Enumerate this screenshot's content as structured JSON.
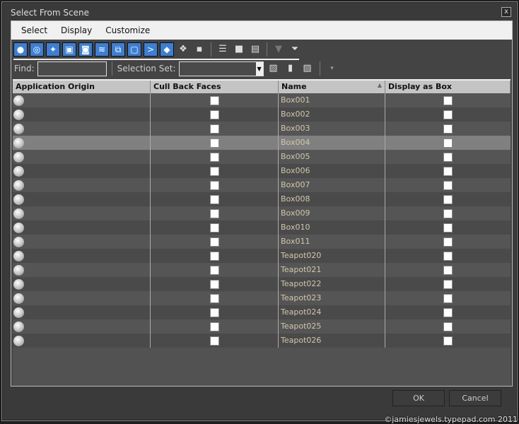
{
  "window": {
    "title": "Select From Scene",
    "close": "x"
  },
  "menu": [
    "Select",
    "Display",
    "Customize"
  ],
  "toolbar": {
    "find_label": "Find:",
    "find_value": "",
    "selection_set_label": "Selection Set:",
    "selection_set_value": ""
  },
  "columns": [
    "Application Origin",
    "Cull Back Faces",
    "Name",
    "Display as Box"
  ],
  "sort_indicator": "▲",
  "rows": [
    "Box001",
    "Box002",
    "Box003",
    "Box004",
    "Box005",
    "Box006",
    "Box007",
    "Box008",
    "Box009",
    "Box010",
    "Box011",
    "Teapot020",
    "Teapot021",
    "Teapot022",
    "Teapot023",
    "Teapot024",
    "Teapot025",
    "Teapot026"
  ],
  "selected_row": "Box004",
  "buttons": {
    "ok": "OK",
    "cancel": "Cancel"
  },
  "watermark": "©jamiesjewels.typepad.com 2011"
}
